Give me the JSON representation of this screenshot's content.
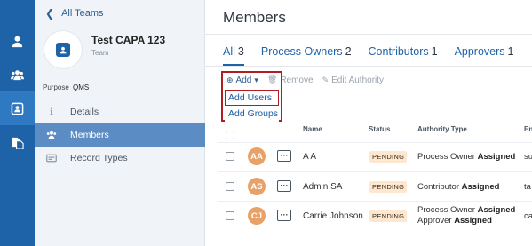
{
  "rail": {
    "icons": [
      "user-icon",
      "group-icon",
      "team-icon",
      "documents-icon"
    ],
    "active_index": 2,
    "accent": "#1e63a8"
  },
  "sidebar": {
    "back_label": "All Teams",
    "team_name": "Test CAPA 123",
    "team_type": "Team",
    "purpose_label": "Purpose",
    "purpose_value": "QMS",
    "nav": [
      {
        "label": "Details",
        "icon": "info-icon",
        "active": false
      },
      {
        "label": "Members",
        "icon": "members-icon",
        "active": true
      },
      {
        "label": "Record Types",
        "icon": "record-types-icon",
        "active": false
      }
    ]
  },
  "main": {
    "title": "Members",
    "tabs": [
      {
        "label": "All",
        "count": "3",
        "active": true
      },
      {
        "label": "Process Owners",
        "count": "2",
        "active": false
      },
      {
        "label": "Contributors",
        "count": "1",
        "active": false
      },
      {
        "label": "Approvers",
        "count": "1",
        "active": false
      }
    ],
    "toolbar": {
      "add_label": "Add",
      "remove_label": "Remove",
      "edit_authority_label": "Edit Authority"
    },
    "add_menu": [
      "Add Users",
      "Add Groups"
    ],
    "table": {
      "headers": {
        "name": "Name",
        "status": "Status",
        "authority": "Authority Type",
        "email": "En"
      },
      "rows": [
        {
          "initials": "AA",
          "name": "A A",
          "status": "PENDING",
          "auth_line1": "Process Owner ",
          "auth_bold1": "Assigned",
          "auth_line2": "",
          "auth_bold2": "",
          "email": "su"
        },
        {
          "initials": "AS",
          "name": "Admin SA",
          "status": "PENDING",
          "auth_line1": "Contributor ",
          "auth_bold1": "Assigned",
          "auth_line2": "",
          "auth_bold2": "",
          "email": "ta"
        },
        {
          "initials": "CJ",
          "name": "Carrie Johnson",
          "status": "PENDING",
          "auth_line1": "Process Owner ",
          "auth_bold1": "Assigned",
          "auth_line2": "Approver ",
          "auth_bold2": "Assigned",
          "email": "ca"
        }
      ]
    }
  },
  "colors": {
    "avatar": "#e8a267",
    "badge_bg": "#fde7cf",
    "highlight_border": "#b01e23",
    "sidebar_active": "#5b8dc4"
  }
}
